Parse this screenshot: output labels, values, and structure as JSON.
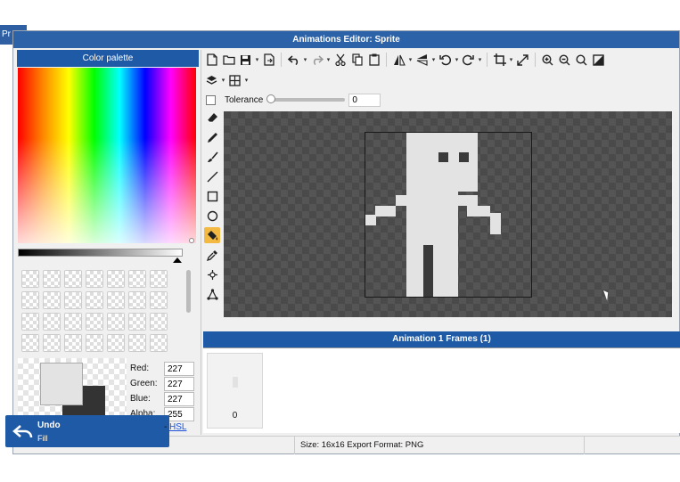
{
  "background": {
    "label": "Pr"
  },
  "window": {
    "title": "Animations Editor: Sprite"
  },
  "palette": {
    "title": "Color palette",
    "channels": [
      {
        "label": "Red:",
        "value": "227"
      },
      {
        "label": "Green:",
        "value": "227"
      },
      {
        "label": "Blue:",
        "value": "227"
      },
      {
        "label": "Alpha:",
        "value": "255"
      }
    ],
    "mode_separator": "-",
    "mode_link": "HSL",
    "colors": {
      "primary": "#e3e3e3",
      "secondary": "#333333"
    }
  },
  "toolbar": {
    "tolerance_label": "Tolerance",
    "tolerance_value": "0",
    "tolerance_level": 0,
    "icons": [
      "new-file-icon",
      "open-folder-icon",
      "save-icon",
      "export-icon",
      "undo-icon",
      "redo-icon",
      "cut-icon",
      "copy-icon",
      "paste-icon",
      "flip-horizontal-icon",
      "flip-vertical-icon",
      "rotate-left-icon",
      "rotate-right-icon",
      "crop-icon",
      "resize-icon",
      "zoom-in-icon",
      "zoom-out-icon",
      "zoom-fit-icon",
      "contrast-icon",
      "layers-icon",
      "grid-icon"
    ]
  },
  "tools": [
    "eraser-icon",
    "pencil-icon",
    "brush-icon",
    "line-icon",
    "rectangle-icon",
    "circle-icon",
    "fill-bucket-icon",
    "eyedropper-icon",
    "select-point-icon",
    "transform-icon"
  ],
  "active_tool": "fill-bucket-icon",
  "frames": {
    "title": "Animation 1 Frames (1)",
    "items": [
      {
        "number": "0"
      }
    ]
  },
  "status": {
    "text": "Size: 16x16   Export Format: PNG"
  },
  "toast": {
    "title": "Undo",
    "subtitle": "Fill"
  },
  "accent": "#1f5aa6",
  "sprite_color": "#e3e3e3"
}
